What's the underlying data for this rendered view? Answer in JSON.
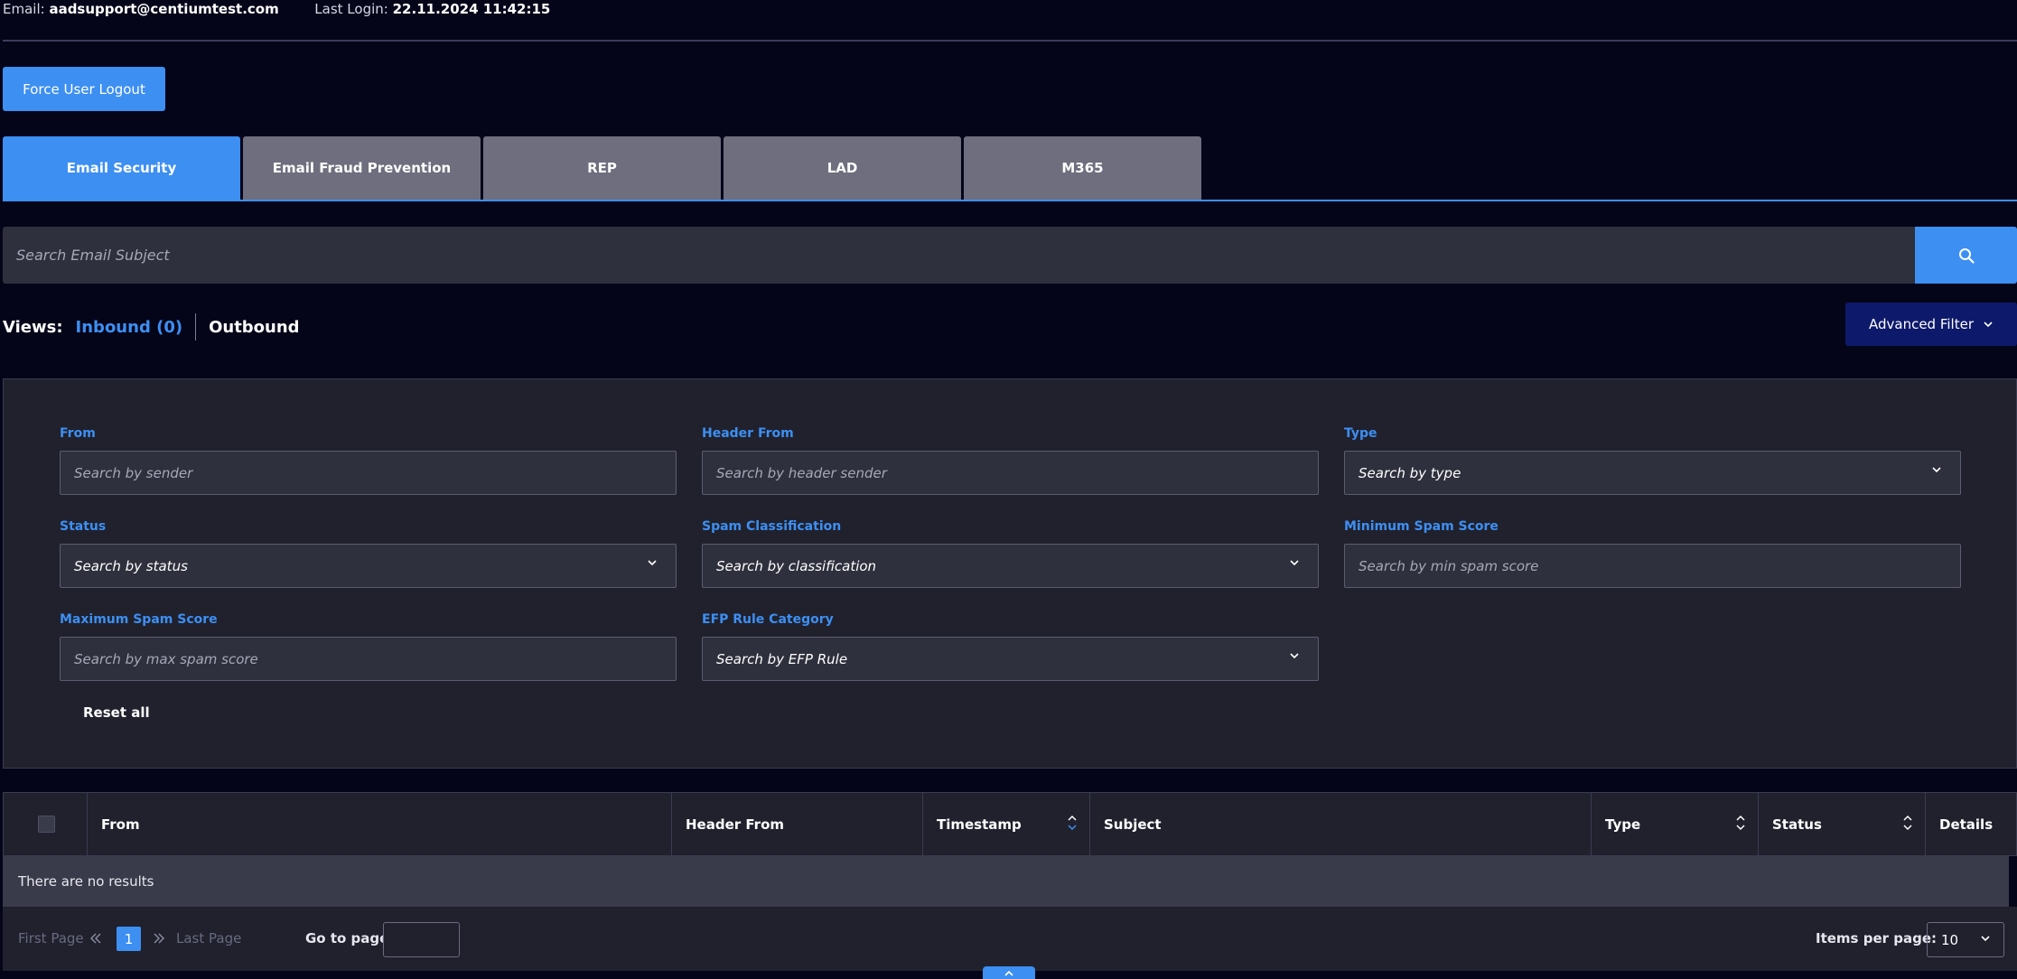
{
  "header": {
    "email_label": "Email:",
    "email_value": "aadsupport@centiumtest.com",
    "login_label": "Last Login:",
    "login_value": "22.11.2024  11:42:15"
  },
  "force_logout_label": "Force User Logout",
  "tabs": [
    {
      "label": "Email Security",
      "active": true
    },
    {
      "label": "Email Fraud Prevention",
      "active": false
    },
    {
      "label": "REP",
      "active": false
    },
    {
      "label": "LAD",
      "active": false
    },
    {
      "label": "M365",
      "active": false
    }
  ],
  "search": {
    "placeholder": "Search Email Subject",
    "icon": "search-icon"
  },
  "views": {
    "label": "Views:",
    "inbound": "Inbound (0)",
    "outbound": "Outbound"
  },
  "advanced_filter_label": "Advanced Filter",
  "filters": {
    "from": {
      "label": "From",
      "placeholder": "Search by sender"
    },
    "header_from": {
      "label": "Header From",
      "placeholder": "Search by header sender"
    },
    "type": {
      "label": "Type",
      "value": "Search by type"
    },
    "status": {
      "label": "Status",
      "value": "Search by status"
    },
    "spam_classification": {
      "label": "Spam Classification",
      "value": "Search by classification"
    },
    "min_spam": {
      "label": "Minimum Spam Score",
      "placeholder": "Search by min spam score"
    },
    "max_spam": {
      "label": "Maximum Spam Score",
      "placeholder": "Search by max spam score"
    },
    "efp_rule": {
      "label": "EFP Rule Category",
      "value": "Search by EFP Rule"
    },
    "reset_label": "Reset all"
  },
  "table": {
    "columns": [
      "From",
      "Header From",
      "Timestamp",
      "Subject",
      "Type",
      "Status",
      "Details"
    ],
    "empty_message": "There are no results"
  },
  "pagination": {
    "first": "First Page",
    "last": "Last Page",
    "current": "1",
    "goto_label": "Go to page:",
    "items_label": "Items per page:",
    "items_value": "10"
  },
  "colors": {
    "accent": "#3d8ff2",
    "background": "#05051a",
    "panel": "#20212d",
    "advanced_button": "#0d1a6b"
  }
}
